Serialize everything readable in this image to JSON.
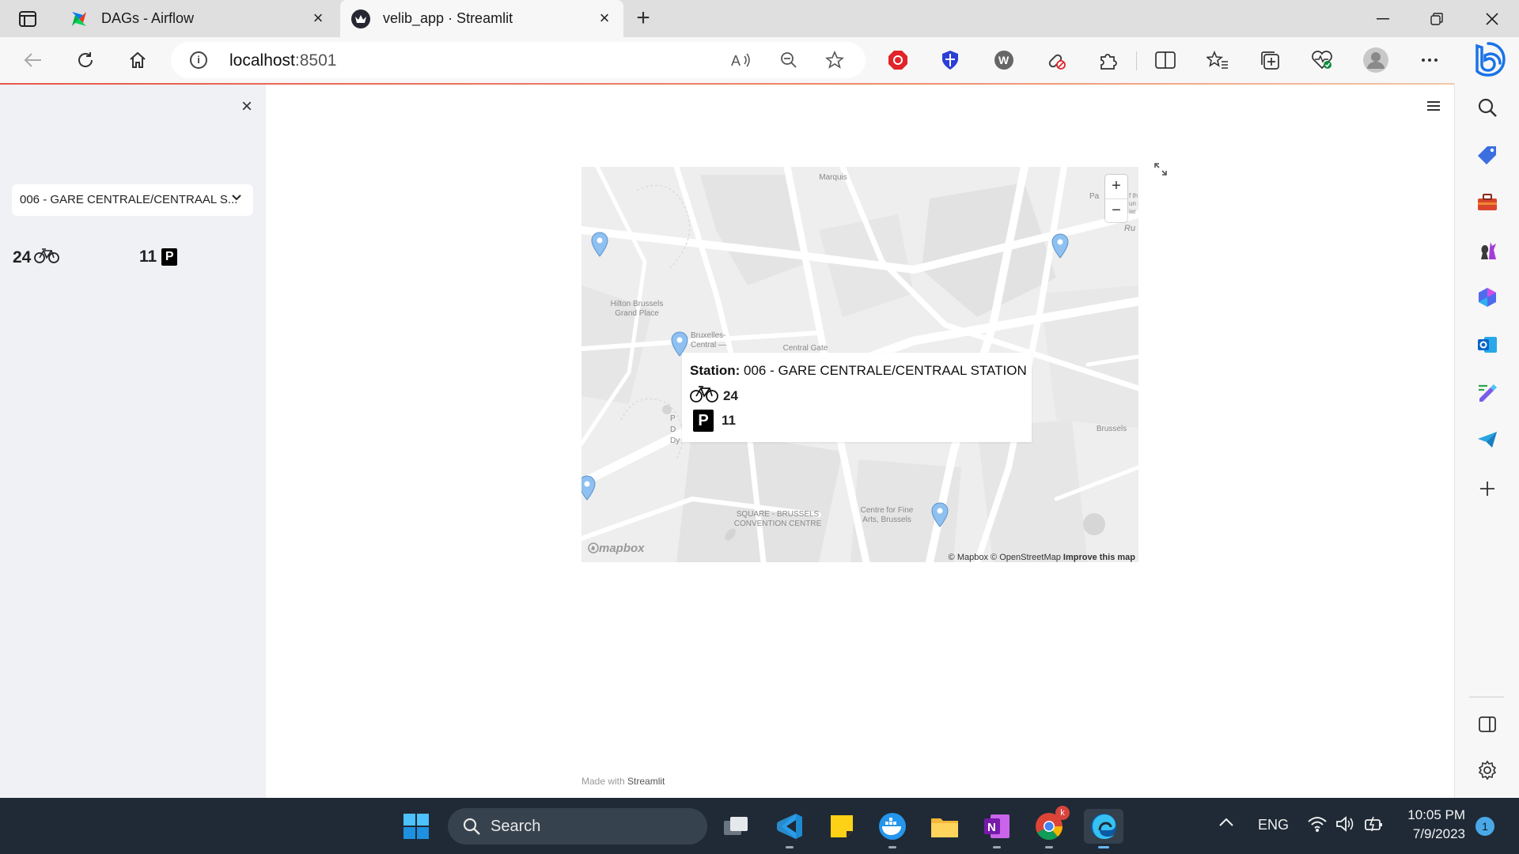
{
  "browser": {
    "tabs": [
      {
        "title": "DAGs - Airflow",
        "active": false
      },
      {
        "title": "velib_app · Streamlit",
        "active": true
      }
    ],
    "url_host": "localhost",
    "url_port": ":8501"
  },
  "sidebar": {
    "selected_station": "006 - GARE CENTRALE/CENTRAAL S...",
    "bikes_available": "24",
    "docks_available": "11",
    "parking_label": "P"
  },
  "map": {
    "labels": {
      "marquis": "Marquis",
      "hilton": "Hilton Brussels Grand Place",
      "bruxelles_central": "Bruxelles-Central —",
      "central_gate": "Central Gate",
      "brussels": "Brussels",
      "square": "SQUARE - BRUSSELS CONVENTION CENTRE",
      "fine_arts": "Centre for Fine Arts, Brussels",
      "ru": "Ru",
      "pa": "Pa",
      "edge_text": "f th\nun I\niar",
      "p_side": "P\nD\nDy"
    },
    "zoom_in": "+",
    "zoom_out": "−",
    "popup": {
      "station_label": "Station:",
      "station_name": "006 - GARE CENTRALE/CENTRAAL STATION",
      "bikes": "24",
      "docks": "11",
      "parking_label": "P"
    },
    "logo": "mapbox",
    "attribution_mapbox": "© Mapbox",
    "attribution_osm": "© OpenStreetMap",
    "attribution_improve": "Improve this map",
    "marker_color": "#8ec0f0"
  },
  "footer": {
    "made_with": "Made with",
    "streamlit": "Streamlit"
  },
  "taskbar": {
    "search_label": "Search",
    "language": "ENG",
    "time": "10:05 PM",
    "date": "7/9/2023",
    "notification_count": "1",
    "chrome_badge": "k"
  },
  "colors": {
    "accent_edge": "#1a73e8",
    "streamlit_sidebar": "#eff1f5",
    "taskbar": "#1f2a36"
  }
}
